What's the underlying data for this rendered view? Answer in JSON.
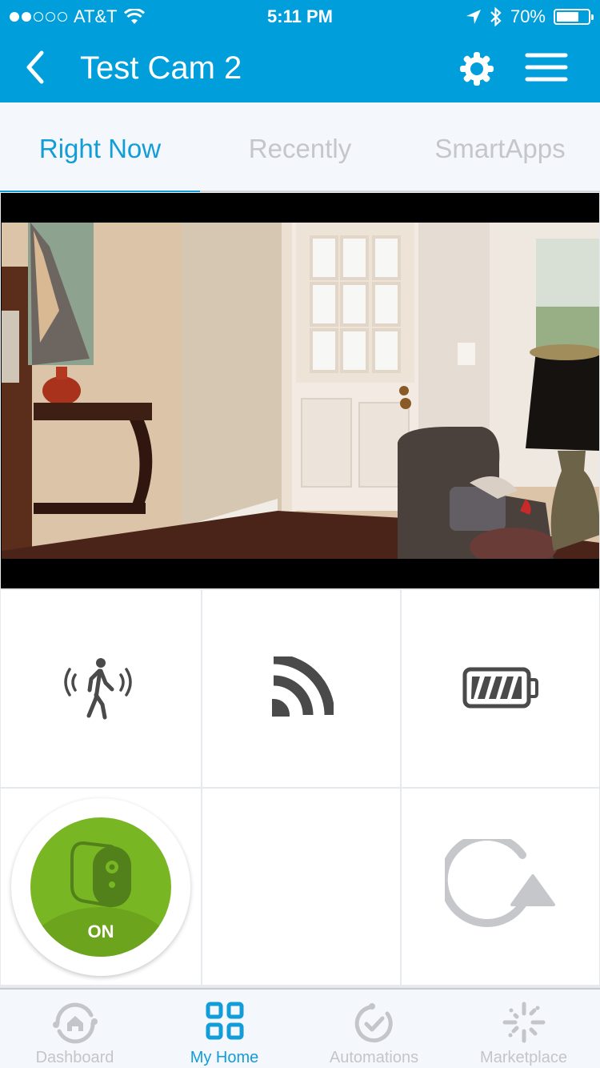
{
  "status_bar": {
    "signal_strength": 2,
    "signal_max": 5,
    "carrier": "AT&T",
    "time": "5:11 PM",
    "battery_percent_label": "70%",
    "battery_level": 0.7,
    "icons": [
      "wifi-icon",
      "location-arrow-icon",
      "bluetooth-icon",
      "battery-icon"
    ]
  },
  "nav_bar": {
    "title": "Test Cam 2",
    "back_icon": "chevron-left-icon",
    "settings_icon": "gear-icon",
    "menu_icon": "hamburger-menu-icon"
  },
  "tabs": [
    {
      "label": "Right Now",
      "active": true
    },
    {
      "label": "Recently",
      "active": false
    },
    {
      "label": "SmartApps",
      "active": false
    }
  ],
  "camera": {
    "feed_description": "Live camera view of living room entryway with white door, console table, armchair and lamp"
  },
  "tiles": [
    {
      "icon": "motion-sensor-icon",
      "label": ""
    },
    {
      "icon": "signal-strength-icon",
      "label": ""
    },
    {
      "icon": "battery-full-icon",
      "label": ""
    },
    {
      "icon": "camera-power-icon",
      "label": "ON",
      "state": "on"
    },
    {
      "icon": "",
      "label": ""
    },
    {
      "icon": "refresh-icon",
      "label": ""
    }
  ],
  "bottom_nav": [
    {
      "label": "Dashboard",
      "icon": "dashboard-home-icon",
      "active": false
    },
    {
      "label": "My Home",
      "icon": "grid-icon",
      "active": true
    },
    {
      "label": "Automations",
      "icon": "automations-check-icon",
      "active": false
    },
    {
      "label": "Marketplace",
      "icon": "marketplace-burst-icon",
      "active": false
    }
  ],
  "colors": {
    "brand_blue": "#009fdb",
    "active_tab": "#129dd8",
    "inactive_text": "#c4c6ca",
    "power_on_green": "#79b623",
    "icon_dark": "#4a4a4a",
    "icon_gray": "#c6c7cb"
  }
}
